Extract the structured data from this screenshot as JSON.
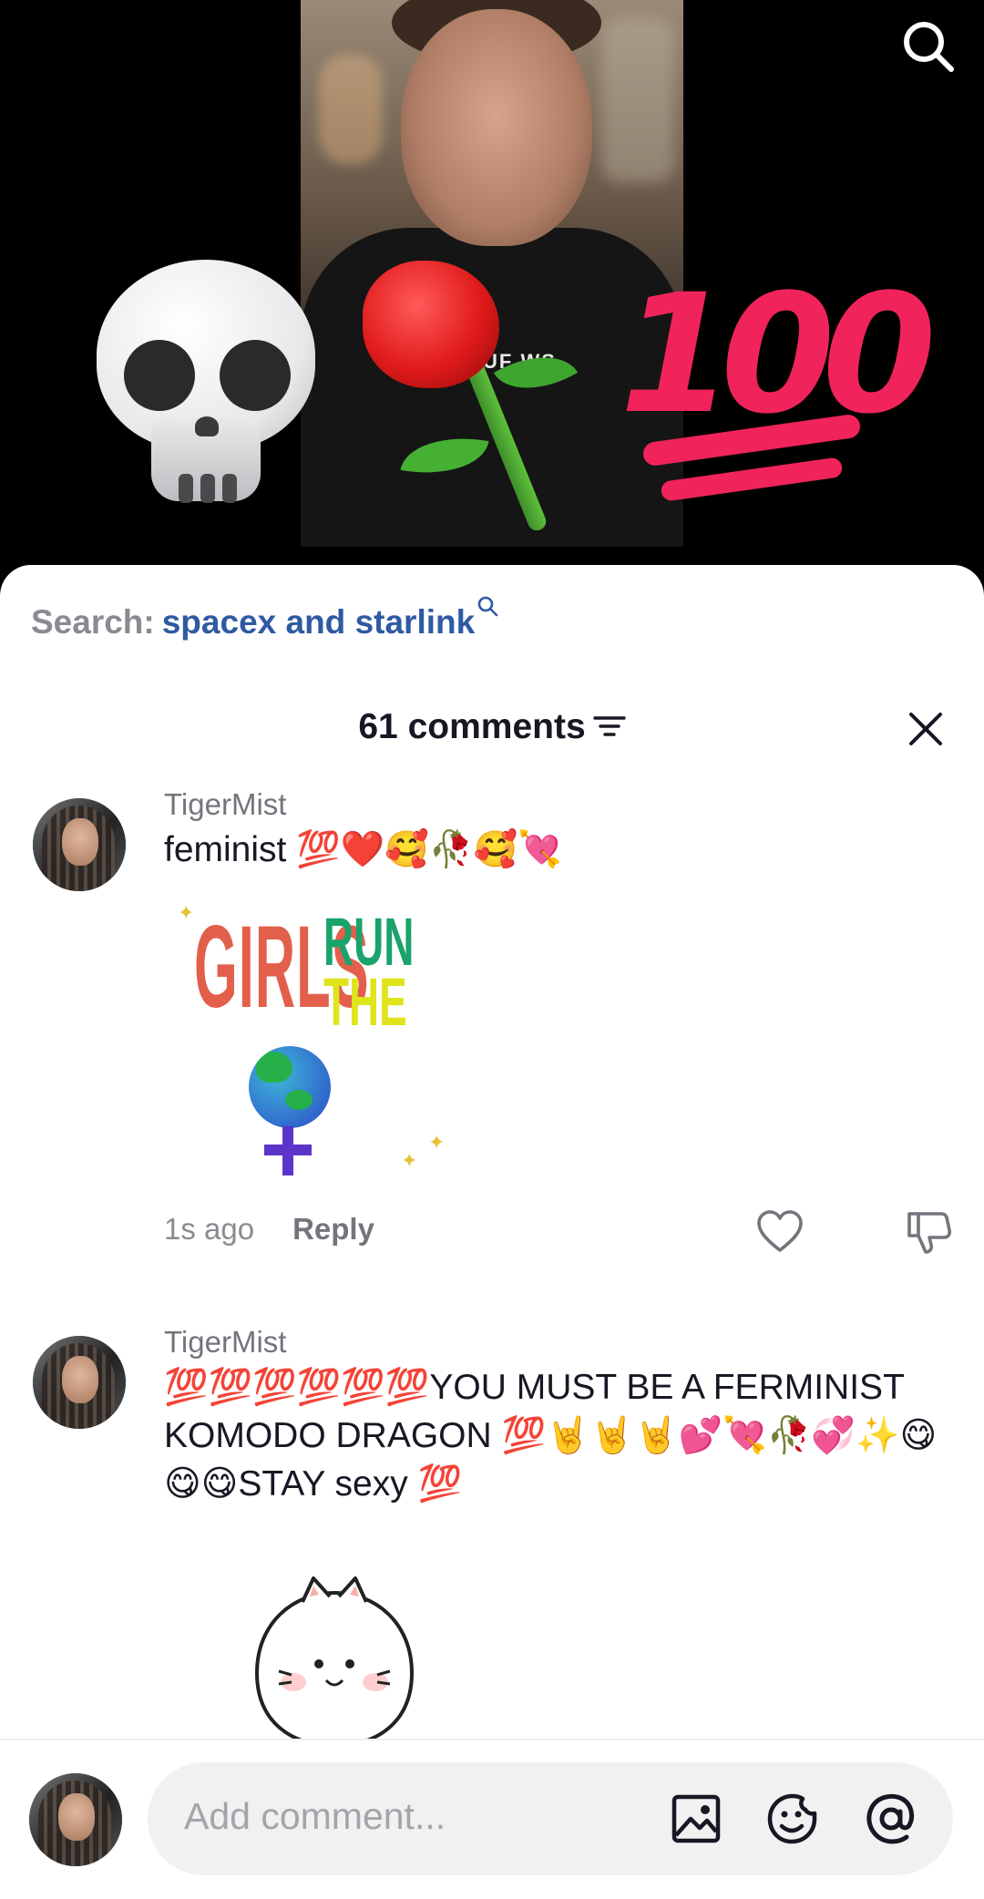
{
  "video": {
    "shirt_text": "UF  WS",
    "overlay_emojis": [
      "skull",
      "rose",
      "hundred-points"
    ],
    "hundred_text": "100"
  },
  "search": {
    "label": "Search:",
    "term": "spacex and starlink"
  },
  "comments_header": {
    "title": "61 comments"
  },
  "comments": [
    {
      "username": "TigerMist",
      "text": "feminist 💯❤️🥰🥀🥰💘",
      "sticker": {
        "type": "girls-run-the-world",
        "text_girls": "GIRLS",
        "text_run": "RUN",
        "text_the": "THE"
      },
      "time": "1s ago",
      "reply_label": "Reply"
    },
    {
      "username": "TigerMist",
      "text": "💯💯💯💯💯💯YOU MUST BE A FERMINIST KOMODO DRAGON 💯🤘🤘🤘💕💘🥀💞✨😋😋😋STAY sexy 💯",
      "sticker": {
        "type": "white-cat"
      }
    }
  ],
  "composer": {
    "placeholder": "Add comment..."
  },
  "colors": {
    "link_blue": "#2f5aa3",
    "muted_text": "#73757c",
    "hundred_red": "#f0245a"
  },
  "icons": [
    "search-icon",
    "filter-icon",
    "close-icon",
    "heart-icon",
    "dislike-icon",
    "image-icon",
    "emoji-icon",
    "mention-icon"
  ]
}
